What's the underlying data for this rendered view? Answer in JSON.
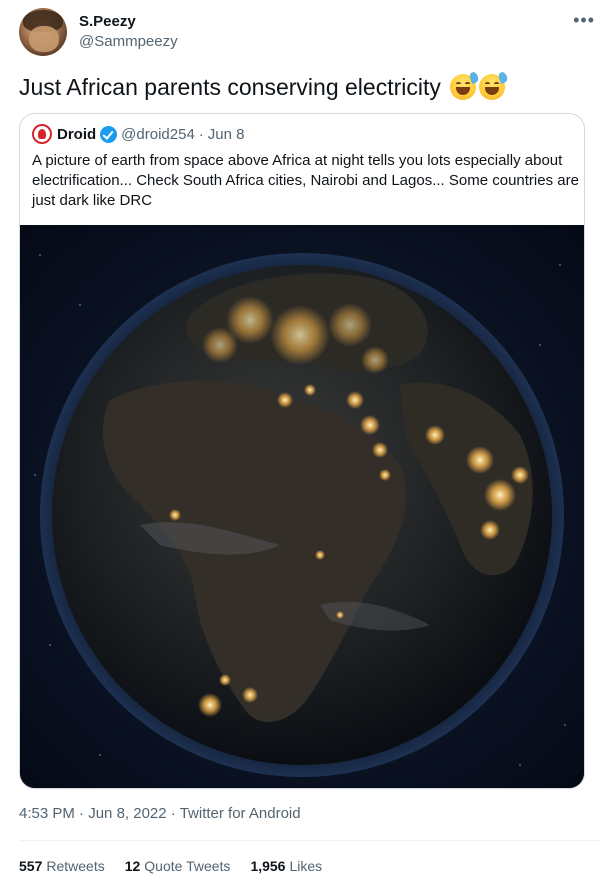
{
  "author": {
    "display_name": "S.Peezy",
    "handle": "@Sammpeezy"
  },
  "more_icon": "more-horizontal-icon",
  "tweet_text": "Just African parents conserving electricity",
  "tweet_emoji": [
    "grinning-sweat-emoji",
    "grinning-sweat-emoji"
  ],
  "quoted_tweet": {
    "display_name": "Droid",
    "verified": true,
    "handle": "@droid254",
    "separator": "·",
    "date": "Jun 8",
    "text": "A picture of earth from space above Africa at night tells you lots especially about electrification... Check South Africa cities, Nairobi and Lagos... Some countries are just dark like DRC",
    "media": "earth-at-night-image"
  },
  "meta": {
    "time": "4:53 PM",
    "date": "Jun 8, 2022",
    "client": "Twitter for Android",
    "separator": "·"
  },
  "stats": {
    "retweets_count": "557",
    "retweets_label": "Retweets",
    "quotes_count": "12",
    "quotes_label": "Quote Tweets",
    "likes_count": "1,956",
    "likes_label": "Likes"
  },
  "colors": {
    "text_primary": "#0f1419",
    "text_secondary": "#536471",
    "verified_blue": "#1d9bf0",
    "border": "#cfd9de"
  }
}
